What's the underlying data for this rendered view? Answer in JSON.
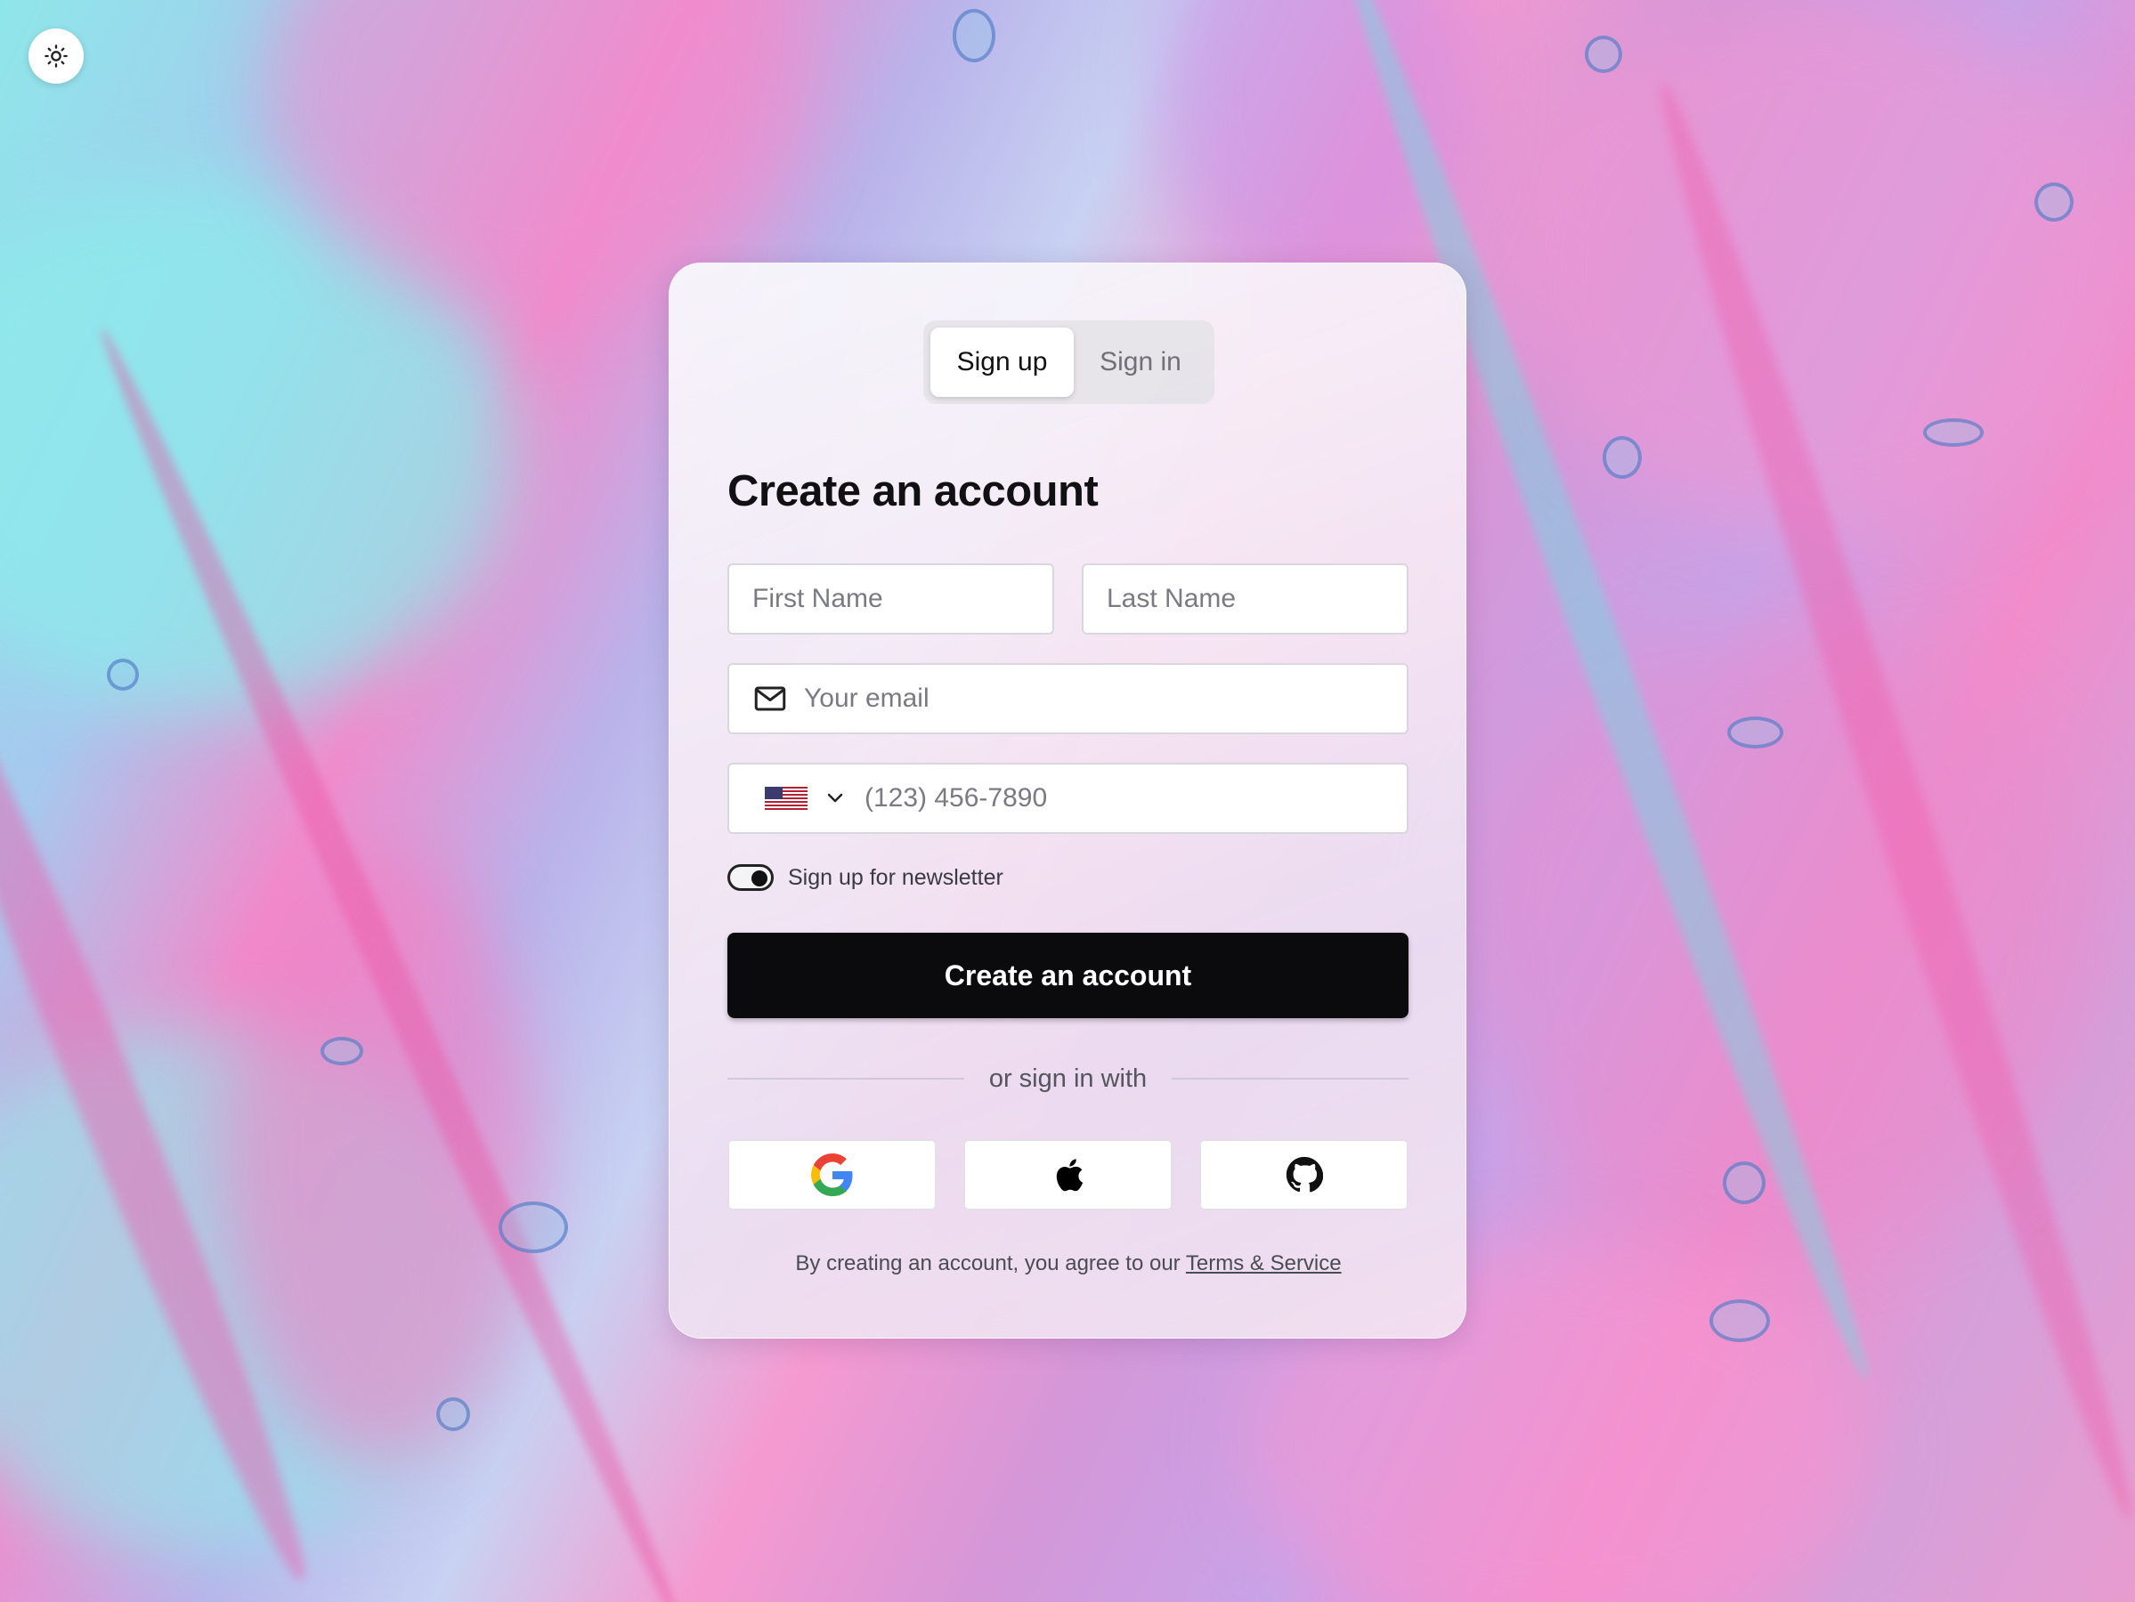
{
  "theme_toggle": {
    "icon": "sun-icon"
  },
  "tabs": [
    {
      "label": "Sign up",
      "active": true
    },
    {
      "label": "Sign in",
      "active": false
    }
  ],
  "form": {
    "title": "Create an account",
    "first_name": {
      "placeholder": "First Name",
      "value": ""
    },
    "last_name": {
      "placeholder": "Last Name",
      "value": ""
    },
    "email": {
      "placeholder": "Your email",
      "value": "",
      "icon": "mail-icon"
    },
    "phone": {
      "placeholder": "(123) 456-7890",
      "value": "",
      "country_flag": "us-flag-icon"
    },
    "newsletter": {
      "label": "Sign up for newsletter",
      "checked": true
    },
    "submit_label": "Create an account",
    "divider_text": "or sign in with",
    "social_buttons": [
      {
        "provider": "google",
        "icon": "google-icon"
      },
      {
        "provider": "apple",
        "icon": "apple-icon"
      },
      {
        "provider": "github",
        "icon": "github-icon"
      }
    ],
    "legal": {
      "prefix": "By creating an account, you agree to our",
      "link_text": "Terms & Service"
    }
  },
  "colors": {
    "primary_button": "#0b0b0d",
    "card_bg": "#f5eaf4",
    "accent_pink": "#f08ccc",
    "accent_cyan": "#8fe6ea"
  }
}
